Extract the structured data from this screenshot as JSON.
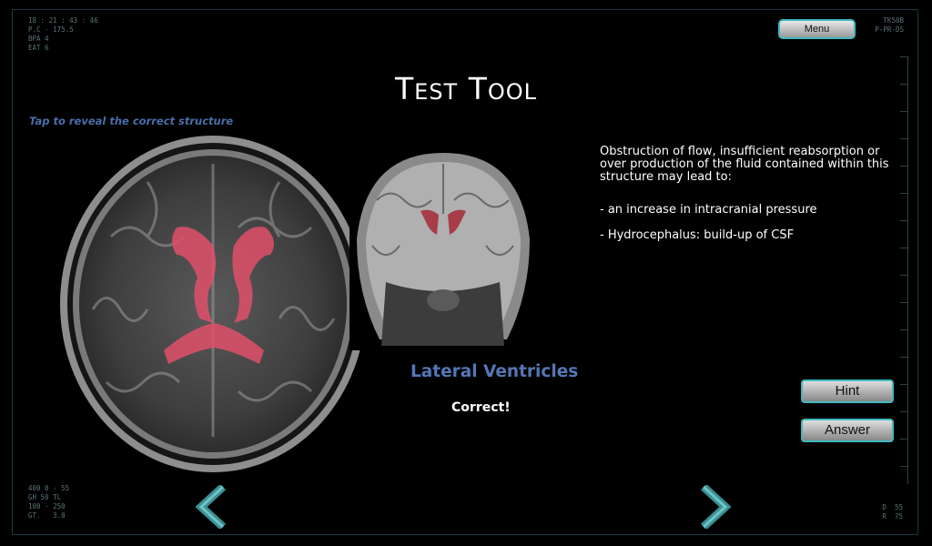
{
  "title": {
    "first_letter": "T",
    "first_rest": "EST",
    "second_letter": "T",
    "second_rest": "OOL"
  },
  "hud": {
    "top_left": "18 : 21 : 43 : 46\nP.C - 175.5\nBPA 4\nEAT 6",
    "top_right": "TK50B\nP-PR-DS",
    "bottom_left": "400 0 - 55\nGH 50 TL\n100 - 250\nGT.   3.0",
    "bottom_right": "D  55\nR  75"
  },
  "instruction": "Tap to reveal the correct structure",
  "menu_label": "Menu",
  "info": {
    "intro": "Obstruction of flow, insufficient reabsorption or over production of the fluid contained within this structure may lead to:",
    "points": [
      "- an increase in intracranial pressure",
      "- Hydrocephalus: build-up of CSF"
    ]
  },
  "structure_name": "Lateral Ventricles",
  "feedback": "Correct!",
  "hint_label": "Hint",
  "answer_label": "Answer",
  "icons": {
    "prev": "chevron-left-icon",
    "next": "chevron-right-icon"
  },
  "colors": {
    "accent_teal": "#3fb9bf",
    "structure_blue": "#5477b5",
    "highlight": "#e0506a"
  }
}
